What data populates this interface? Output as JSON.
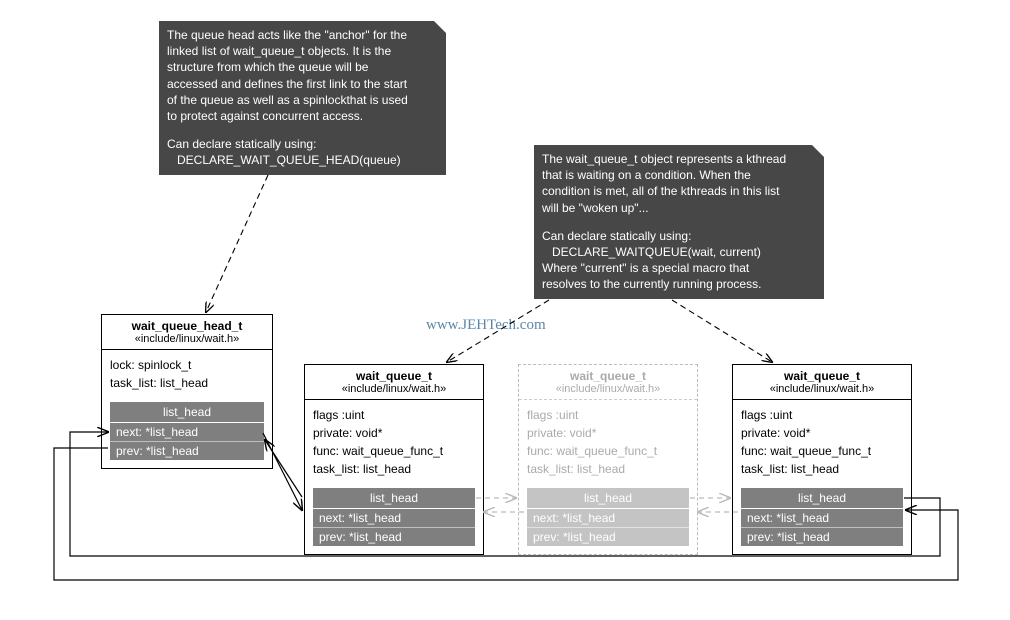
{
  "watermark": "www.JEHTech.com",
  "notes": {
    "head": {
      "lines": [
        "The queue head acts like the \"anchor\" for the",
        "linked list of wait_queue_t objects. It is the",
        "structure from which the queue will be",
        "accessed and defines the first link to the start",
        "of the queue as well as a spinlockthat is used",
        "to protect against concurrent access."
      ],
      "declare1": "Can declare statically using:",
      "declare2": "DECLARE_WAIT_QUEUE_HEAD(queue)"
    },
    "entry": {
      "lines": [
        "The wait_queue_t object represents a kthread",
        "that is waiting on a condition. When the",
        "condition is met, all of the kthreads in this list",
        "will be \"woken up\"..."
      ],
      "declare1": "Can declare statically using:",
      "declare2": "DECLARE_WAITQUEUE(wait, current)",
      "extra1": "Where \"current\" is a special macro that",
      "extra2": "resolves to the currently running process."
    }
  },
  "head_class": {
    "title": "wait_queue_head_t",
    "include": "«include/linux/wait.h»",
    "attrs": [
      "lock: spinlock_t",
      "task_list: list_head"
    ],
    "listhead": {
      "title": "list_head",
      "next": "next: *list_head",
      "prev": "prev: *list_head"
    }
  },
  "entry_class": {
    "title": "wait_queue_t",
    "include": "«include/linux/wait.h»",
    "attrs": [
      "flags :uint",
      "private: void*",
      "func: wait_queue_func_t",
      "task_list: list_head"
    ],
    "listhead": {
      "title": "list_head",
      "next": "next: *list_head",
      "prev": "prev: *list_head"
    }
  }
}
